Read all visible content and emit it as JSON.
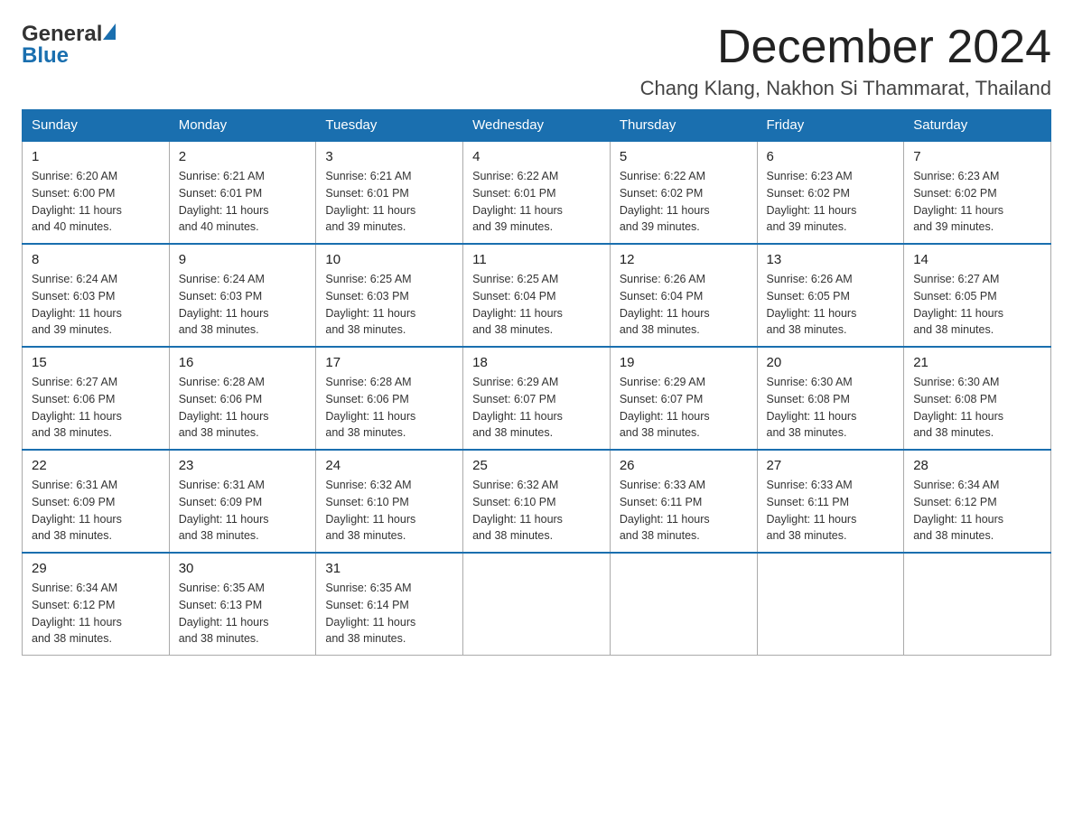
{
  "header": {
    "logo_general": "General",
    "logo_blue": "Blue",
    "month_title": "December 2024",
    "location": "Chang Klang, Nakhon Si Thammarat, Thailand"
  },
  "days_of_week": [
    "Sunday",
    "Monday",
    "Tuesday",
    "Wednesday",
    "Thursday",
    "Friday",
    "Saturday"
  ],
  "weeks": [
    [
      {
        "day": "1",
        "sunrise": "6:20 AM",
        "sunset": "6:00 PM",
        "daylight": "11 hours and 40 minutes."
      },
      {
        "day": "2",
        "sunrise": "6:21 AM",
        "sunset": "6:01 PM",
        "daylight": "11 hours and 40 minutes."
      },
      {
        "day": "3",
        "sunrise": "6:21 AM",
        "sunset": "6:01 PM",
        "daylight": "11 hours and 39 minutes."
      },
      {
        "day": "4",
        "sunrise": "6:22 AM",
        "sunset": "6:01 PM",
        "daylight": "11 hours and 39 minutes."
      },
      {
        "day": "5",
        "sunrise": "6:22 AM",
        "sunset": "6:02 PM",
        "daylight": "11 hours and 39 minutes."
      },
      {
        "day": "6",
        "sunrise": "6:23 AM",
        "sunset": "6:02 PM",
        "daylight": "11 hours and 39 minutes."
      },
      {
        "day": "7",
        "sunrise": "6:23 AM",
        "sunset": "6:02 PM",
        "daylight": "11 hours and 39 minutes."
      }
    ],
    [
      {
        "day": "8",
        "sunrise": "6:24 AM",
        "sunset": "6:03 PM",
        "daylight": "11 hours and 39 minutes."
      },
      {
        "day": "9",
        "sunrise": "6:24 AM",
        "sunset": "6:03 PM",
        "daylight": "11 hours and 38 minutes."
      },
      {
        "day": "10",
        "sunrise": "6:25 AM",
        "sunset": "6:03 PM",
        "daylight": "11 hours and 38 minutes."
      },
      {
        "day": "11",
        "sunrise": "6:25 AM",
        "sunset": "6:04 PM",
        "daylight": "11 hours and 38 minutes."
      },
      {
        "day": "12",
        "sunrise": "6:26 AM",
        "sunset": "6:04 PM",
        "daylight": "11 hours and 38 minutes."
      },
      {
        "day": "13",
        "sunrise": "6:26 AM",
        "sunset": "6:05 PM",
        "daylight": "11 hours and 38 minutes."
      },
      {
        "day": "14",
        "sunrise": "6:27 AM",
        "sunset": "6:05 PM",
        "daylight": "11 hours and 38 minutes."
      }
    ],
    [
      {
        "day": "15",
        "sunrise": "6:27 AM",
        "sunset": "6:06 PM",
        "daylight": "11 hours and 38 minutes."
      },
      {
        "day": "16",
        "sunrise": "6:28 AM",
        "sunset": "6:06 PM",
        "daylight": "11 hours and 38 minutes."
      },
      {
        "day": "17",
        "sunrise": "6:28 AM",
        "sunset": "6:06 PM",
        "daylight": "11 hours and 38 minutes."
      },
      {
        "day": "18",
        "sunrise": "6:29 AM",
        "sunset": "6:07 PM",
        "daylight": "11 hours and 38 minutes."
      },
      {
        "day": "19",
        "sunrise": "6:29 AM",
        "sunset": "6:07 PM",
        "daylight": "11 hours and 38 minutes."
      },
      {
        "day": "20",
        "sunrise": "6:30 AM",
        "sunset": "6:08 PM",
        "daylight": "11 hours and 38 minutes."
      },
      {
        "day": "21",
        "sunrise": "6:30 AM",
        "sunset": "6:08 PM",
        "daylight": "11 hours and 38 minutes."
      }
    ],
    [
      {
        "day": "22",
        "sunrise": "6:31 AM",
        "sunset": "6:09 PM",
        "daylight": "11 hours and 38 minutes."
      },
      {
        "day": "23",
        "sunrise": "6:31 AM",
        "sunset": "6:09 PM",
        "daylight": "11 hours and 38 minutes."
      },
      {
        "day": "24",
        "sunrise": "6:32 AM",
        "sunset": "6:10 PM",
        "daylight": "11 hours and 38 minutes."
      },
      {
        "day": "25",
        "sunrise": "6:32 AM",
        "sunset": "6:10 PM",
        "daylight": "11 hours and 38 minutes."
      },
      {
        "day": "26",
        "sunrise": "6:33 AM",
        "sunset": "6:11 PM",
        "daylight": "11 hours and 38 minutes."
      },
      {
        "day": "27",
        "sunrise": "6:33 AM",
        "sunset": "6:11 PM",
        "daylight": "11 hours and 38 minutes."
      },
      {
        "day": "28",
        "sunrise": "6:34 AM",
        "sunset": "6:12 PM",
        "daylight": "11 hours and 38 minutes."
      }
    ],
    [
      {
        "day": "29",
        "sunrise": "6:34 AM",
        "sunset": "6:12 PM",
        "daylight": "11 hours and 38 minutes."
      },
      {
        "day": "30",
        "sunrise": "6:35 AM",
        "sunset": "6:13 PM",
        "daylight": "11 hours and 38 minutes."
      },
      {
        "day": "31",
        "sunrise": "6:35 AM",
        "sunset": "6:14 PM",
        "daylight": "11 hours and 38 minutes."
      },
      null,
      null,
      null,
      null
    ]
  ],
  "labels": {
    "sunrise": "Sunrise:",
    "sunset": "Sunset:",
    "daylight": "Daylight:"
  }
}
